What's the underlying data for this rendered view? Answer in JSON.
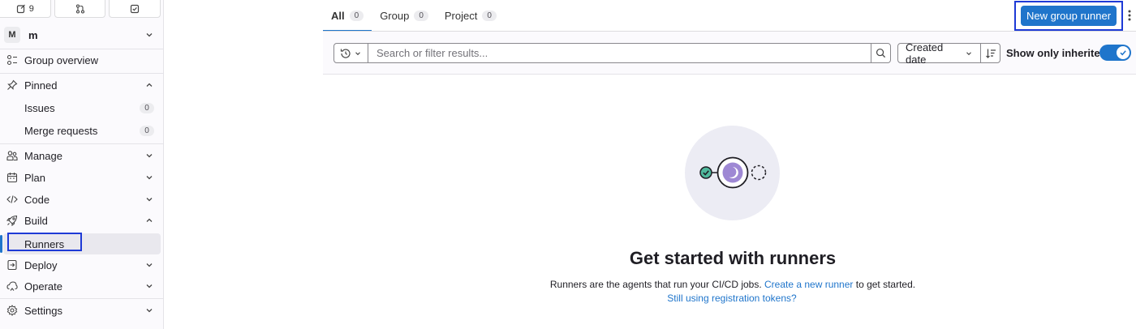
{
  "sidebar": {
    "top": {
      "issues_count": "9"
    },
    "group": {
      "avatar": "M",
      "name": "m"
    },
    "overview": "Group overview",
    "pinned": {
      "label": "Pinned",
      "items": [
        {
          "label": "Issues",
          "count": "0"
        },
        {
          "label": "Merge requests",
          "count": "0"
        }
      ]
    },
    "manage": "Manage",
    "plan": "Plan",
    "code": "Code",
    "build": {
      "label": "Build",
      "runners": "Runners"
    },
    "deploy": "Deploy",
    "operate": "Operate",
    "settings": "Settings"
  },
  "tabs": [
    {
      "label": "All",
      "count": "0"
    },
    {
      "label": "Group",
      "count": "0"
    },
    {
      "label": "Project",
      "count": "0"
    }
  ],
  "actions": {
    "new_runner": "New group runner"
  },
  "filter": {
    "search_placeholder": "Search or filter results...",
    "sort_label": "Created date",
    "inherited_label": "Show only inherited",
    "inherited_on": true
  },
  "empty_state": {
    "title": "Get started with runners",
    "desc_before": "Runners are the agents that run your CI/CD jobs. ",
    "desc_link": "Create a new runner",
    "desc_after": " to get started.",
    "tokens_link": "Still using registration tokens?"
  },
  "colors": {
    "accent": "#1f75cb",
    "highlight": "#1e3ad6",
    "illus_bg": "#ececf4",
    "illus_purple": "#9e88d4",
    "check_green": "#4fb89c"
  }
}
